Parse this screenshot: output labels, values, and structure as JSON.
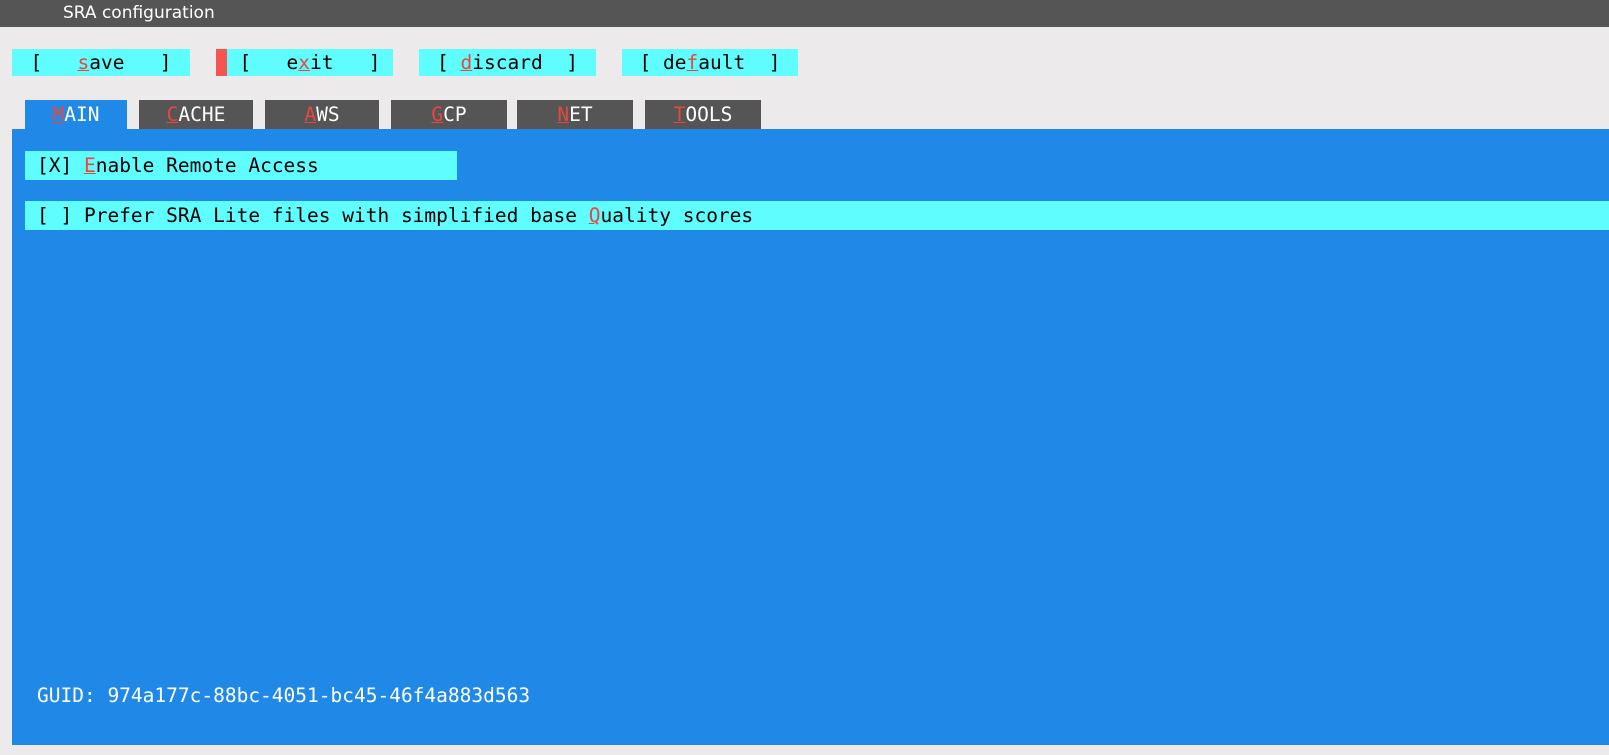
{
  "window": {
    "title": "SRA configuration"
  },
  "toolbar": {
    "buttons": [
      {
        "label": "[   save   ]",
        "hotkey": "s",
        "hotkey_index": 4,
        "cursor": false
      },
      {
        "label": "[   exit   ]",
        "hotkey": "x",
        "hotkey_index": 6,
        "cursor": true
      },
      {
        "label": "[ discard  ]",
        "hotkey": "d",
        "hotkey_index": 2,
        "cursor": false
      },
      {
        "label": "[ default  ]",
        "hotkey": "f",
        "hotkey_index": 4,
        "cursor": false
      }
    ]
  },
  "tabs": [
    {
      "label": "MAIN",
      "hotkey": "M",
      "active": true
    },
    {
      "label": "CACHE",
      "hotkey": "C",
      "active": false
    },
    {
      "label": "AWS",
      "hotkey": "A",
      "active": false
    },
    {
      "label": "GCP",
      "hotkey": "G",
      "active": false
    },
    {
      "label": "NET",
      "hotkey": "N",
      "active": false
    },
    {
      "label": "TOOLS",
      "hotkey": "T",
      "active": false
    }
  ],
  "main": {
    "checkboxes": [
      {
        "box": "[X]",
        "checked": "X",
        "label": "Enable Remote Access",
        "hotkey": "E",
        "full_text": "[X] Enable Remote Access"
      },
      {
        "box": "[ ]",
        "checked": "",
        "label": "Prefer SRA Lite files with simplified base Quality scores",
        "hotkey": "Q",
        "full_text": "[ ] Prefer SRA Lite files with simplified base Quality scores"
      }
    ],
    "guid_label": "GUID:",
    "guid_value": "974a177c-88bc-4051-bc45-46f4a883d563",
    "guid_line": "GUID: 974a177c-88bc-4051-bc45-46f4a883d563"
  },
  "colors": {
    "titlebar_bg": "#555555",
    "window_bg": "#eceaea",
    "panel_blue": "#2089e8",
    "widget_cyan": "#5ffdfd",
    "hotkey_red": "#e8473f",
    "cursor_red": "#f6554f",
    "tab_inactive_bg": "#555555",
    "text_white": "#ffffff",
    "text_black": "#000000"
  }
}
